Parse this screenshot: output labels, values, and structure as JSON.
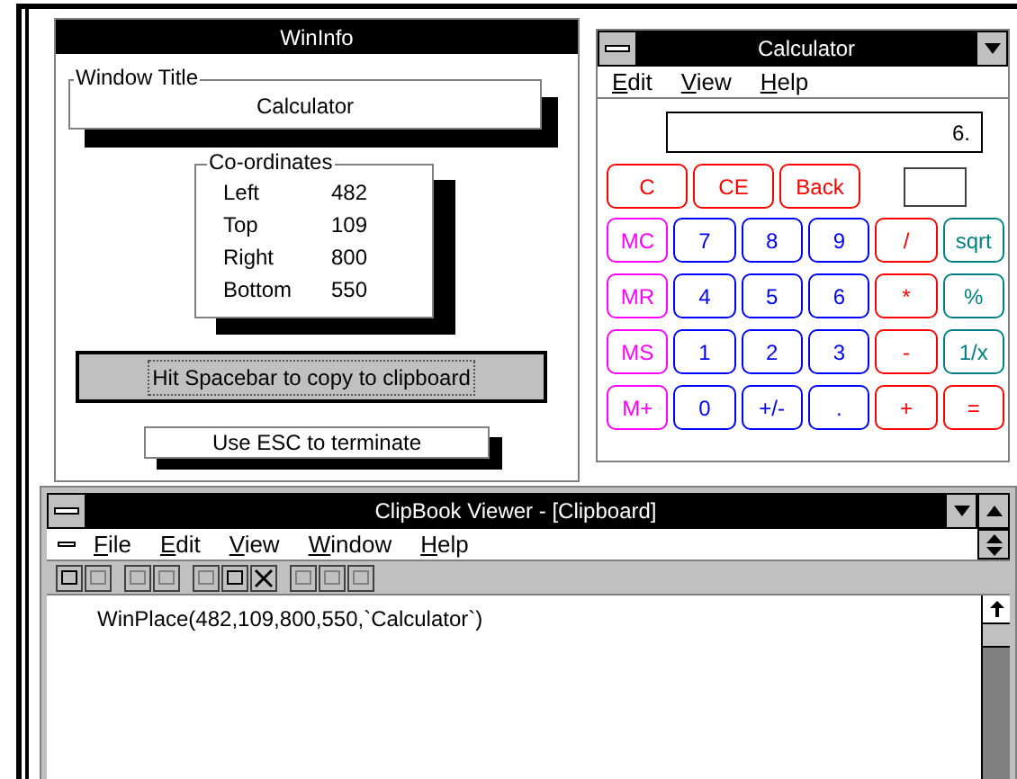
{
  "wininfo": {
    "title": "WinInfo",
    "window_title_label": "Window Title",
    "window_title_value": "Calculator",
    "coords_label": "Co-ordinates",
    "coords": [
      {
        "label": "Left",
        "value": "482"
      },
      {
        "label": "Top",
        "value": "109"
      },
      {
        "label": "Right",
        "value": "800"
      },
      {
        "label": "Bottom",
        "value": "550"
      }
    ],
    "copy_button": "Hit Spacebar to copy to clipboard",
    "esc_note": "Use ESC to terminate"
  },
  "calculator": {
    "title": "Calculator",
    "menu": [
      "Edit",
      "View",
      "Help"
    ],
    "display": "6.",
    "top_keys": [
      {
        "label": "C",
        "color": "#ff0000"
      },
      {
        "label": "CE",
        "color": "#ff0000"
      },
      {
        "label": "Back",
        "color": "#ff0000"
      }
    ],
    "keys": [
      {
        "label": "MC",
        "color": "#ff00ff"
      },
      {
        "label": "7",
        "color": "#0000ff"
      },
      {
        "label": "8",
        "color": "#0000ff"
      },
      {
        "label": "9",
        "color": "#0000ff"
      },
      {
        "label": "/",
        "color": "#ff0000"
      },
      {
        "label": "sqrt",
        "color": "#008080"
      },
      {
        "label": "MR",
        "color": "#ff00ff"
      },
      {
        "label": "4",
        "color": "#0000ff"
      },
      {
        "label": "5",
        "color": "#0000ff"
      },
      {
        "label": "6",
        "color": "#0000ff"
      },
      {
        "label": "*",
        "color": "#ff0000"
      },
      {
        "label": "%",
        "color": "#008080"
      },
      {
        "label": "MS",
        "color": "#ff00ff"
      },
      {
        "label": "1",
        "color": "#0000ff"
      },
      {
        "label": "2",
        "color": "#0000ff"
      },
      {
        "label": "3",
        "color": "#0000ff"
      },
      {
        "label": "-",
        "color": "#ff0000"
      },
      {
        "label": "1/x",
        "color": "#008080"
      },
      {
        "label": "M+",
        "color": "#ff00ff"
      },
      {
        "label": "0",
        "color": "#0000ff"
      },
      {
        "label": "+/-",
        "color": "#0000ff"
      },
      {
        "label": ".",
        "color": "#0000ff"
      },
      {
        "label": "+",
        "color": "#ff0000"
      },
      {
        "label": "=",
        "color": "#ff0000"
      }
    ]
  },
  "clipbook": {
    "title": "ClipBook Viewer - [Clipboard]",
    "menu": [
      "File",
      "Edit",
      "View",
      "Window",
      "Help"
    ],
    "content": "WinPlace(482,109,800,550,`Calculator`)"
  }
}
